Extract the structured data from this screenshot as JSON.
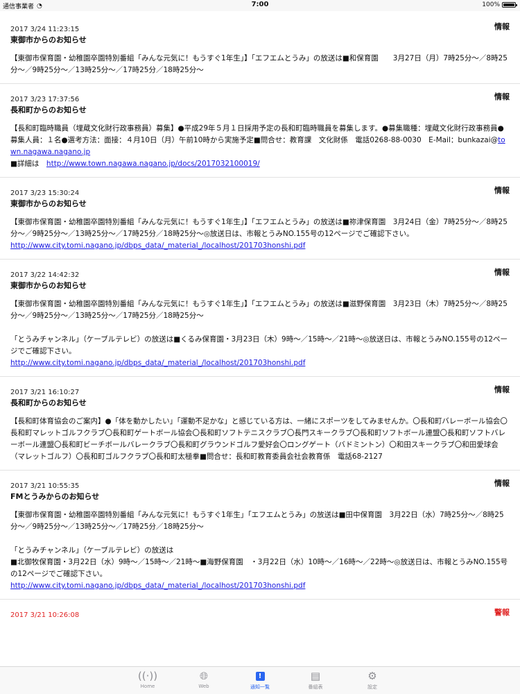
{
  "status_bar": {
    "carrier": "通信事業者",
    "time": "7:00",
    "battery": "100%"
  },
  "items": [
    {
      "date": "2017 3/24 11:23:15",
      "category": "情報",
      "title": "東御市からのお知らせ",
      "body": "【東御市保育園・幼稚園卒園特別番組「みんな元気に！もうすぐ1年生」】「エフエムとうみ」の放送は■和保育園　　3月27日（月）7時25分～／8時25分～／9時25分～／13時25分～／17時25分／18時25分～",
      "link": ""
    },
    {
      "date": "2017 3/23 17:37:56",
      "category": "情報",
      "title": "長和町からのお知らせ",
      "body": "【長和町臨時職員（埋蔵文化財行政事務員）募集】●平成29年５月１日採用予定の長和町臨時職員を募集します。●募集職種：埋蔵文化財行政事務員●募集人員：１名●選考方法：面接：４月10日（月）午前10時から実施予定■問合せ：教育課　文化財係　電話0268-88-0030　E-Mail：bunkazai@",
      "link_inline": "town.nagawa.nagano.jp",
      "detail_label": "■詳細は　",
      "link": "http://www.town.nagawa.nagano.jp/docs/2017032100019/"
    },
    {
      "date": "2017 3/23 15:30:24",
      "category": "情報",
      "title": "東御市からのお知らせ",
      "body": "【東御市保育園・幼稚園卒園特別番組「みんな元気に！もうすぐ1年生」】「エフエムとうみ」の放送は■祢津保育園　3月24日（金）7時25分～／8時25分～／9時25分～／13時25分～／17時25分／18時25分～◎放送日は、市報とうみNO.155号の12ページでご確認下さい。",
      "link": "http://www.city.tomi.nagano.jp/dbps_data/_material_/localhost/201703honshi.pdf"
    },
    {
      "date": "2017 3/22 14:42:32",
      "category": "情報",
      "title": "東御市からのお知らせ",
      "body": "【東御市保育園・幼稚園卒園特別番組「みんな元気に！もうすぐ1年生」】「エフエムとうみ」の放送は■滋野保育園　3月23日（木）7時25分～／8時25分～／9時25分～／13時25分～／17時25分／18時25分～\n\n「とうみチャンネル」（ケーブルテレビ）の放送は■くるみ保育園・3月23日（木）9時～／15時～／21時～◎放送日は、市報とうみNO.155号の12ページでご確認下さい。",
      "link": "http://www.city.tomi.nagano.jp/dbps_data/_material_/localhost/201703honshi.pdf"
    },
    {
      "date": "2017 3/21 16:10:27",
      "category": "情報",
      "title": "長和町からのお知らせ",
      "body": "【長和町体育協会のご案内】●「体を動かしたい」「運動不足かな」と感じている方は、一緒にスポーツをしてみませんか。〇長和町バレーボール協会〇長和町マレットゴルフクラブ〇長和町ゲートボール協会〇長和町ソフトテニスクラブ〇長門スキークラブ〇長和町ソフトボール連盟〇長和町ソフトバレーボール連盟〇長和町ビーチボールバレークラブ〇長和町グラウンドゴルフ愛好会〇ロングゲート（バドミントン）〇和田スキークラブ〇和田愛球会（マレットゴルフ）〇長和町ゴルフクラブ〇長和町太極拳■問合せ：長和町教育委員会社会教育係　電話68-2127",
      "link": ""
    },
    {
      "date": "2017 3/21 10:55:35",
      "category": "情報",
      "title": "FMとうみからのお知らせ",
      "body": "【東御市保育園・幼稚園卒園特別番組「みんな元気に！もうすぐ1年生」「エフエムとうみ」の放送は■田中保育園　3月22日（水）7時25分～／8時25分～／9時25分～／13時25分～／17時25分／18時25分～\n\n「とうみチャンネル」（ケーブルテレビ）の放送は\n■北御牧保育園・3月22日（水）9時～／15時～／21時～■海野保育園　・3月22日（水）10時～／16時～／22時～◎放送日は、市報とうみNO.155号の12ページでご確認下さい。",
      "link": "http://www.city.tomi.nagano.jp/dbps_data/_material_/localhost/201703honshi.pdf"
    },
    {
      "date": "2017 3/21 10:26:08",
      "category": "警報",
      "title": "",
      "body": "",
      "link": ""
    }
  ],
  "tabs": [
    {
      "label": "Home",
      "icon": "antenna-icon"
    },
    {
      "label": "Web",
      "icon": "globe-icon"
    },
    {
      "label": "通知一覧",
      "icon": "notice-icon",
      "active": true
    },
    {
      "label": "番組表",
      "icon": "calendar-icon"
    },
    {
      "label": "設定",
      "icon": "gear-icon"
    }
  ],
  "colors": {
    "link": "#1a1ae0",
    "alert": "#e02424",
    "tab_active": "#2a66f0",
    "tab_inactive": "#8e8e93"
  }
}
